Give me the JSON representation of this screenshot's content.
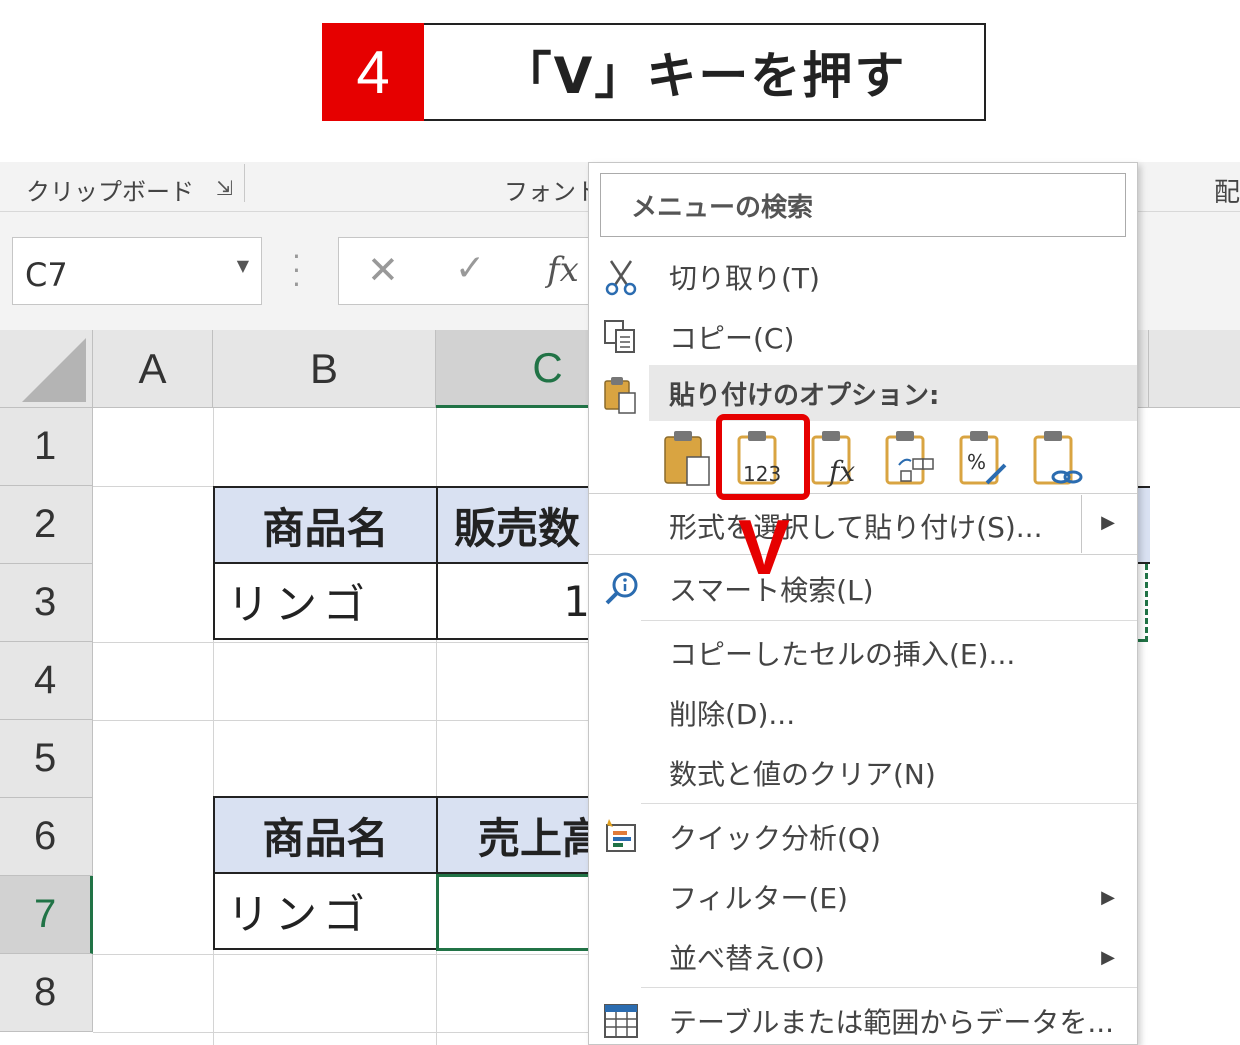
{
  "step": {
    "number": "4",
    "text": "「V」キーを押す"
  },
  "ribbon": {
    "clipboard": "クリップボード",
    "font": "フォント",
    "alignment_partial": "配"
  },
  "formula_bar": {
    "name_box": "C7",
    "fx": "fx"
  },
  "grid": {
    "columns": [
      "A",
      "B",
      "C"
    ],
    "rows": [
      "1",
      "2",
      "3",
      "4",
      "5",
      "6",
      "7",
      "8"
    ],
    "table1": {
      "header_b": "商品名",
      "header_c": "販売数",
      "row_b": "リンゴ",
      "row_c": "1"
    },
    "table2": {
      "header_b": "商品名",
      "header_c": "売上高",
      "row_b": "リンゴ",
      "row_c": ""
    }
  },
  "context_menu": {
    "search_placeholder": "メニューの検索",
    "cut": "切り取り(T)",
    "copy": "コピー(C)",
    "paste_options": "貼り付けのオプション:",
    "paste_special": "形式を選択して貼り付け(S)...",
    "smart_lookup": "スマート検索(L)",
    "insert_copied": "コピーしたセルの挿入(E)...",
    "delete": "削除(D)...",
    "clear": "数式と値のクリア(N)",
    "quick_analysis": "クイック分析(Q)",
    "filter": "フィルター(E)",
    "sort": "並べ替え(O)",
    "table_from_range": "テーブルまたは範囲からデータを..."
  },
  "paste_icon_labels": {
    "values": "123",
    "formula": "fx",
    "percent": "%"
  },
  "annotation": {
    "key": "V"
  },
  "colors": {
    "accent_red": "#e60000",
    "excel_green": "#217346",
    "header_blue": "#d9e1f2"
  }
}
